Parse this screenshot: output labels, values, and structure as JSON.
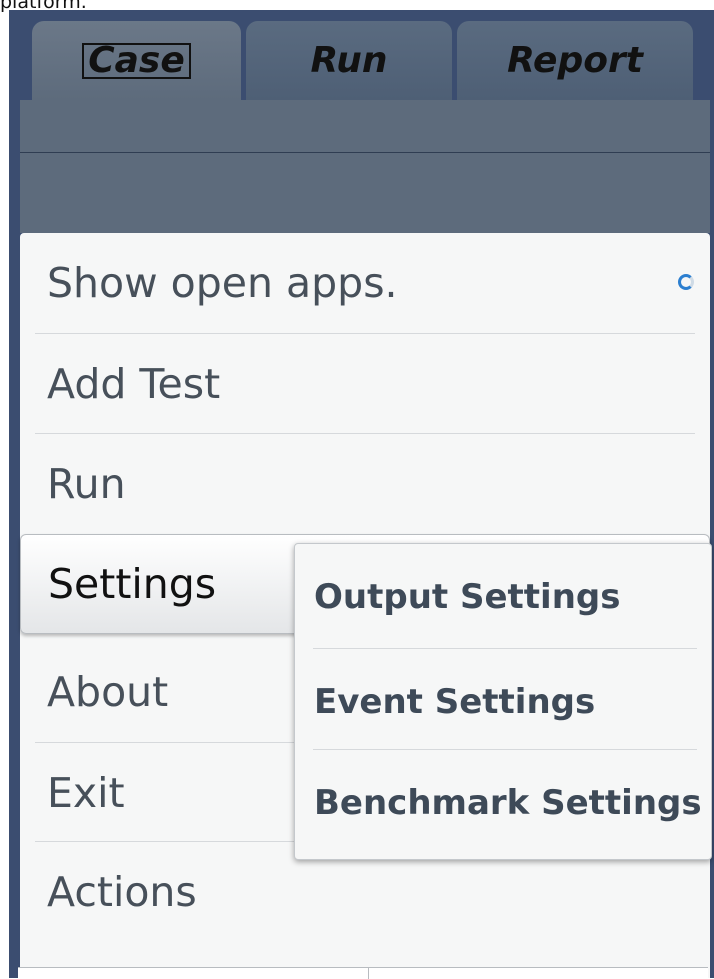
{
  "caption_fragment": "platform.",
  "tabs": [
    {
      "label": "Case",
      "active": true
    },
    {
      "label": "Run",
      "active": false
    },
    {
      "label": "Report",
      "active": false
    }
  ],
  "menu": {
    "items": [
      {
        "label": "Show open apps.",
        "loading_icon": "spinner-icon"
      },
      {
        "label": "Add Test"
      },
      {
        "label": "Run"
      },
      {
        "label": "Settings",
        "selected": true
      },
      {
        "label": "About"
      },
      {
        "label": "Exit"
      },
      {
        "label": "Actions"
      }
    ]
  },
  "submenu": {
    "items": [
      {
        "label": "Output Settings"
      },
      {
        "label": "Event Settings"
      },
      {
        "label": "Benchmark Settings"
      }
    ]
  },
  "colors": {
    "frame": "#3b4d70",
    "tab_bar": "#5d6b7c",
    "menu_bg": "#f6f7f7",
    "menu_text": "#47505a",
    "accent": "#2c7fd0"
  }
}
